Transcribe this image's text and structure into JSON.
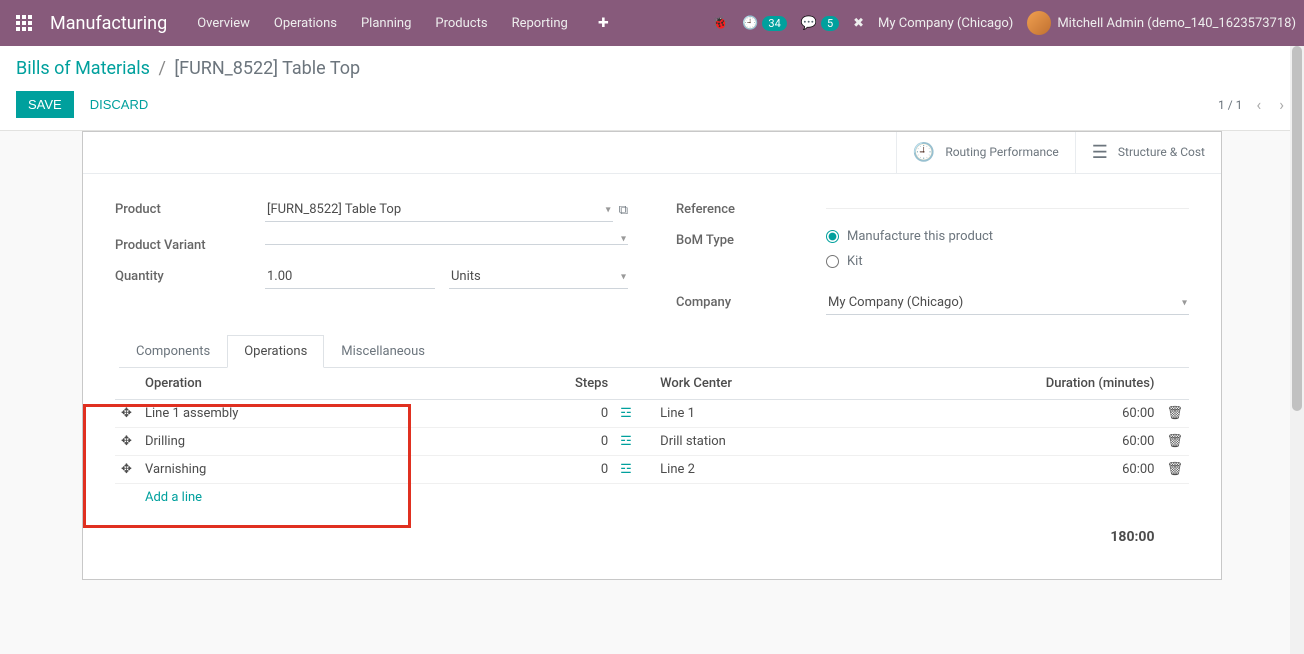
{
  "topnav": {
    "brand": "Manufacturing",
    "menu": [
      "Overview",
      "Operations",
      "Planning",
      "Products",
      "Reporting"
    ],
    "clock_badge": "34",
    "msg_badge": "5",
    "company": "My Company (Chicago)",
    "user": "Mitchell Admin (demo_140_1623573718)"
  },
  "breadcrumb": {
    "parent": "Bills of Materials",
    "current": "[FURN_8522] Table Top"
  },
  "buttons": {
    "save": "SAVE",
    "discard": "DISCARD"
  },
  "pager": {
    "text": "1 / 1"
  },
  "stat_buttons": {
    "routing": "Routing Performance",
    "structure": "Structure & Cost"
  },
  "form": {
    "labels": {
      "product": "Product",
      "variant": "Product Variant",
      "quantity": "Quantity",
      "reference": "Reference",
      "bom_type": "BoM Type",
      "company": "Company"
    },
    "product": "[FURN_8522] Table Top",
    "variant": "",
    "quantity": "1.00",
    "uom": "Units",
    "reference": "",
    "bom_type_options": {
      "manufacture": "Manufacture this product",
      "kit": "Kit"
    },
    "company": "My Company (Chicago)"
  },
  "tabs": {
    "components": "Components",
    "operations": "Operations",
    "misc": "Miscellaneous"
  },
  "table": {
    "headers": {
      "operation": "Operation",
      "steps": "Steps",
      "work_center": "Work Center",
      "duration": "Duration (minutes)"
    },
    "rows": [
      {
        "operation": "Line 1 assembly",
        "steps": "0",
        "work_center": "Line 1",
        "duration": "60:00"
      },
      {
        "operation": "Drilling",
        "steps": "0",
        "work_center": "Drill station",
        "duration": "60:00"
      },
      {
        "operation": "Varnishing",
        "steps": "0",
        "work_center": "Line 2",
        "duration": "60:00"
      }
    ],
    "add_line": "Add a line",
    "total": "180:00"
  }
}
